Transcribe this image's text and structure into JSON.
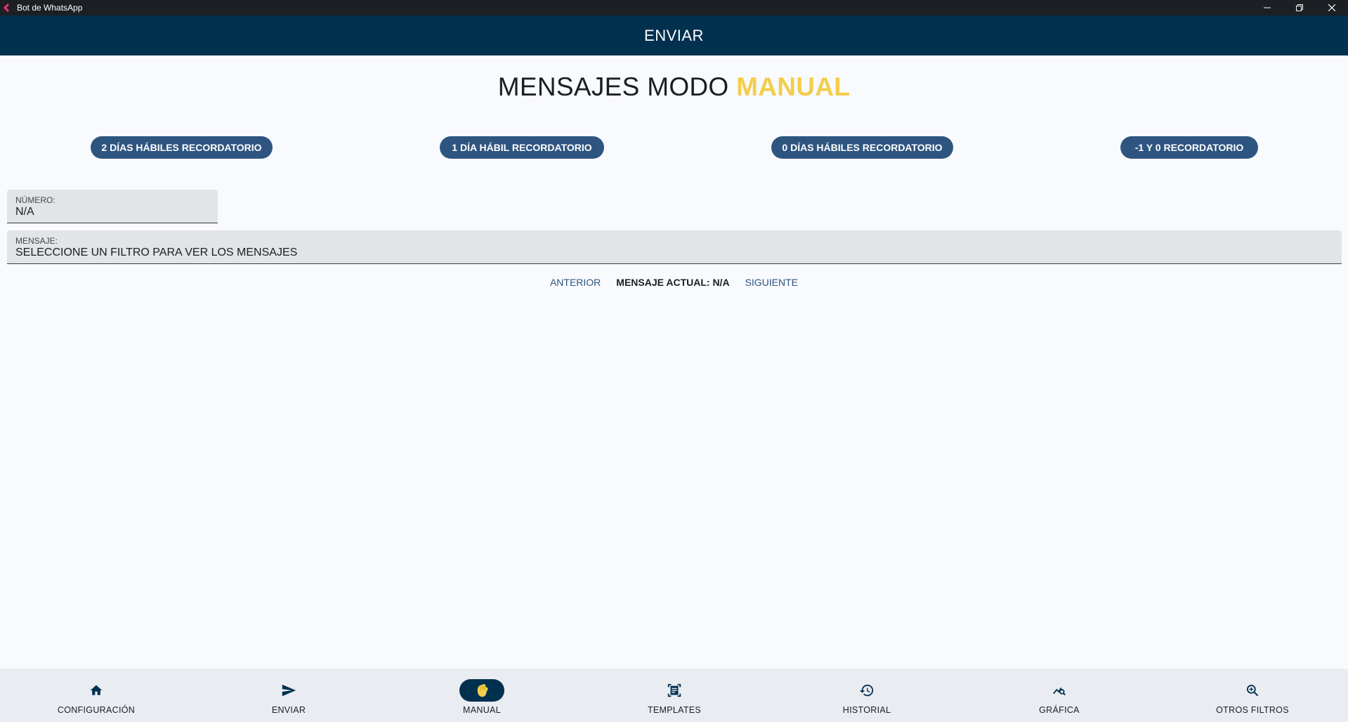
{
  "window": {
    "title": "Bot de WhatsApp"
  },
  "appbar": {
    "title": "ENVIAR"
  },
  "heading": {
    "prefix": "MENSAJES MODO ",
    "accent": "MANUAL"
  },
  "filters": [
    {
      "label": "2 DÍAS HÁBILES RECORDATORIO"
    },
    {
      "label": "1 DÍA HÁBIL RECORDATORIO"
    },
    {
      "label": "0 DÍAS HÁBILES RECORDATORIO"
    },
    {
      "label": "-1 Y 0 RECORDATORIO"
    }
  ],
  "numero": {
    "label": "NÚMERO:",
    "value": "N/A"
  },
  "mensaje": {
    "label": "MENSAJE:",
    "value": "SELECCIONE UN FILTRO PARA VER LOS MENSAJES"
  },
  "pager": {
    "prev": "ANTERIOR",
    "current": "MENSAJE ACTUAL: N/A",
    "next": "SIGUIENTE"
  },
  "nav": [
    {
      "label": "CONFIGURACIÓN",
      "icon": "home-icon"
    },
    {
      "label": "ENVIAR",
      "icon": "send-icon"
    },
    {
      "label": "MANUAL",
      "icon": "waving-hand-icon",
      "active": true
    },
    {
      "label": "TEMPLATES",
      "icon": "document-scanner-icon"
    },
    {
      "label": "HISTORIAL",
      "icon": "history-icon"
    },
    {
      "label": "GRÁFICA",
      "icon": "query-stats-icon"
    },
    {
      "label": "OTROS FILTROS",
      "icon": "zoom-in-icon"
    }
  ],
  "colors": {
    "primary": "#02304f",
    "button": "#2e5580",
    "accent": "#f3cd4c",
    "background": "#f8fafe",
    "nav_background": "#e9ecf1",
    "hand": "#f3cd4c"
  }
}
